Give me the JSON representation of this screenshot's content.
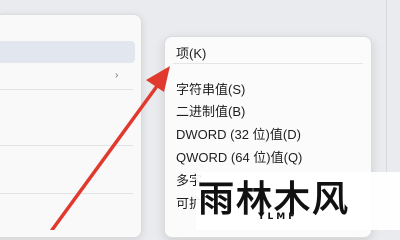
{
  "submenu": {
    "items": [
      {
        "label": "项(K)"
      },
      {
        "label": "字符串值(S)"
      },
      {
        "label": "二进制值(B)"
      },
      {
        "label": "DWORD (32 位)值(D)"
      },
      {
        "label": "QWORD (64 位)值(Q)"
      },
      {
        "label": "多字"
      },
      {
        "label": "可扩"
      }
    ]
  },
  "annotation": {
    "arrow_color": "#e03a2f"
  },
  "watermark": {
    "text": "雨林木风",
    "sub": "YLMF"
  }
}
